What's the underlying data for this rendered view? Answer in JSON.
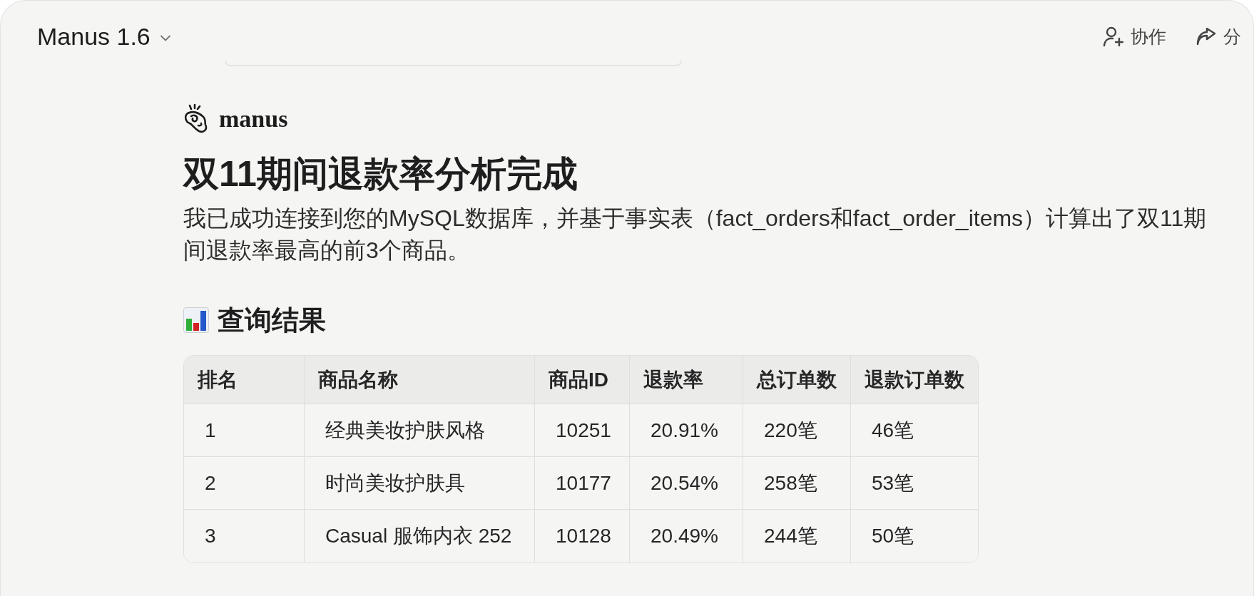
{
  "header": {
    "model_name": "Manus 1.6",
    "actions": [
      {
        "kind": "collaborate",
        "label": "协作"
      },
      {
        "kind": "share",
        "label": "分"
      }
    ]
  },
  "brand": {
    "name": "manus"
  },
  "message": {
    "title": "双11期间退款率分析完成",
    "paragraph": "我已成功连接到您的MySQL数据库，并基于事实表（fact_orders和fact_order_items）计算出了双11期间退款率最高的前3个商品。",
    "section_heading": "查询结果",
    "table": {
      "columns": [
        "排名",
        "商品名称",
        "商品ID",
        "退款率",
        "总订单数",
        "退款订单数"
      ],
      "rows": [
        [
          "1",
          "经典美妆护肤风格",
          "10251",
          "20.91%",
          "220笔",
          "46笔"
        ],
        [
          "2",
          "时尚美妆护肤具",
          "10177",
          "20.54%",
          "258笔",
          "53笔"
        ],
        [
          "3",
          "Casual 服饰内衣 252",
          "10128",
          "20.49%",
          "244笔",
          "50笔"
        ]
      ]
    }
  }
}
